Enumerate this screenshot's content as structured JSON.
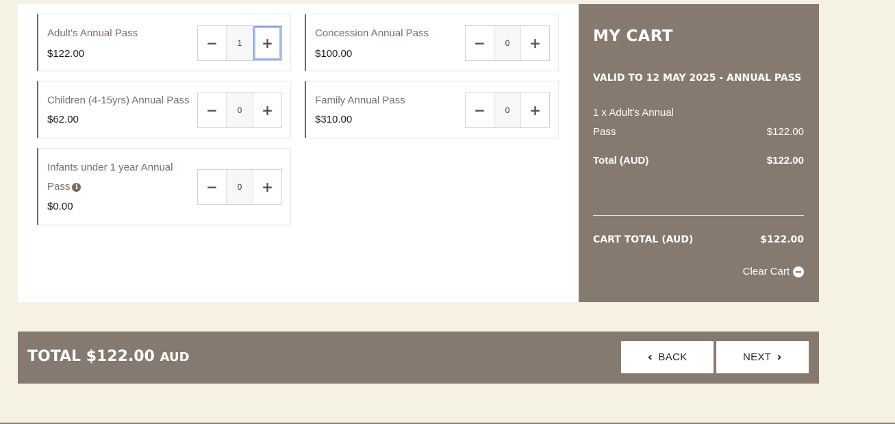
{
  "products": [
    {
      "name": "Adult's Annual Pass",
      "price": "$122.00",
      "qty": "1",
      "info": false
    },
    {
      "name": "Concession Annual Pass",
      "price": "$100.00",
      "qty": "0",
      "info": false
    },
    {
      "name": "Children (4-15yrs) Annual Pass",
      "price": "$62.00",
      "qty": "0",
      "info": false
    },
    {
      "name": "Family Annual Pass",
      "price": "$310.00",
      "qty": "0",
      "info": false
    },
    {
      "name": "Infants under 1 year Annual Pass",
      "price": "$0.00",
      "qty": "0",
      "info": true
    }
  ],
  "stepper": {
    "minus": "−",
    "plus": "+"
  },
  "cart": {
    "title": "MY CART",
    "valid": "VALID TO 12 MAY 2025 - ANNUAL PASS",
    "item_desc": "1 x Adult's Annual Pass",
    "item_amount": "$122.00",
    "total_label": "Total (AUD)",
    "total_amount": "$122.00",
    "cart_total_label": "CART TOTAL (AUD)",
    "cart_total_amount": "$122.00",
    "clear_label": "Clear Cart"
  },
  "footer": {
    "total_label": "TOTAL $122.00",
    "currency": "AUD",
    "back_label": "BACK",
    "next_label": "NEXT"
  }
}
